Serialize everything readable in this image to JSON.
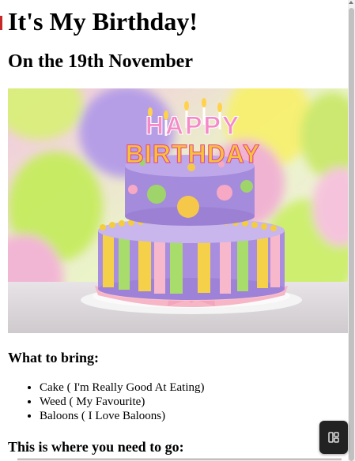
{
  "page": {
    "title": "It's My Birthday!",
    "date_heading": "On the 19th November"
  },
  "photo": {
    "cake_topper_line1": "HAPPY",
    "cake_topper_line2": "BIRTHDAY"
  },
  "bring": {
    "heading": "What to bring:",
    "items": [
      "Cake ( I'm Really Good At Eating)",
      "Weed ( My Favourite)",
      "Baloons ( I Love Baloons)"
    ]
  },
  "directions": {
    "heading": "This is where you need to go:"
  },
  "icons": {
    "side_button": "layout-panel-icon"
  }
}
